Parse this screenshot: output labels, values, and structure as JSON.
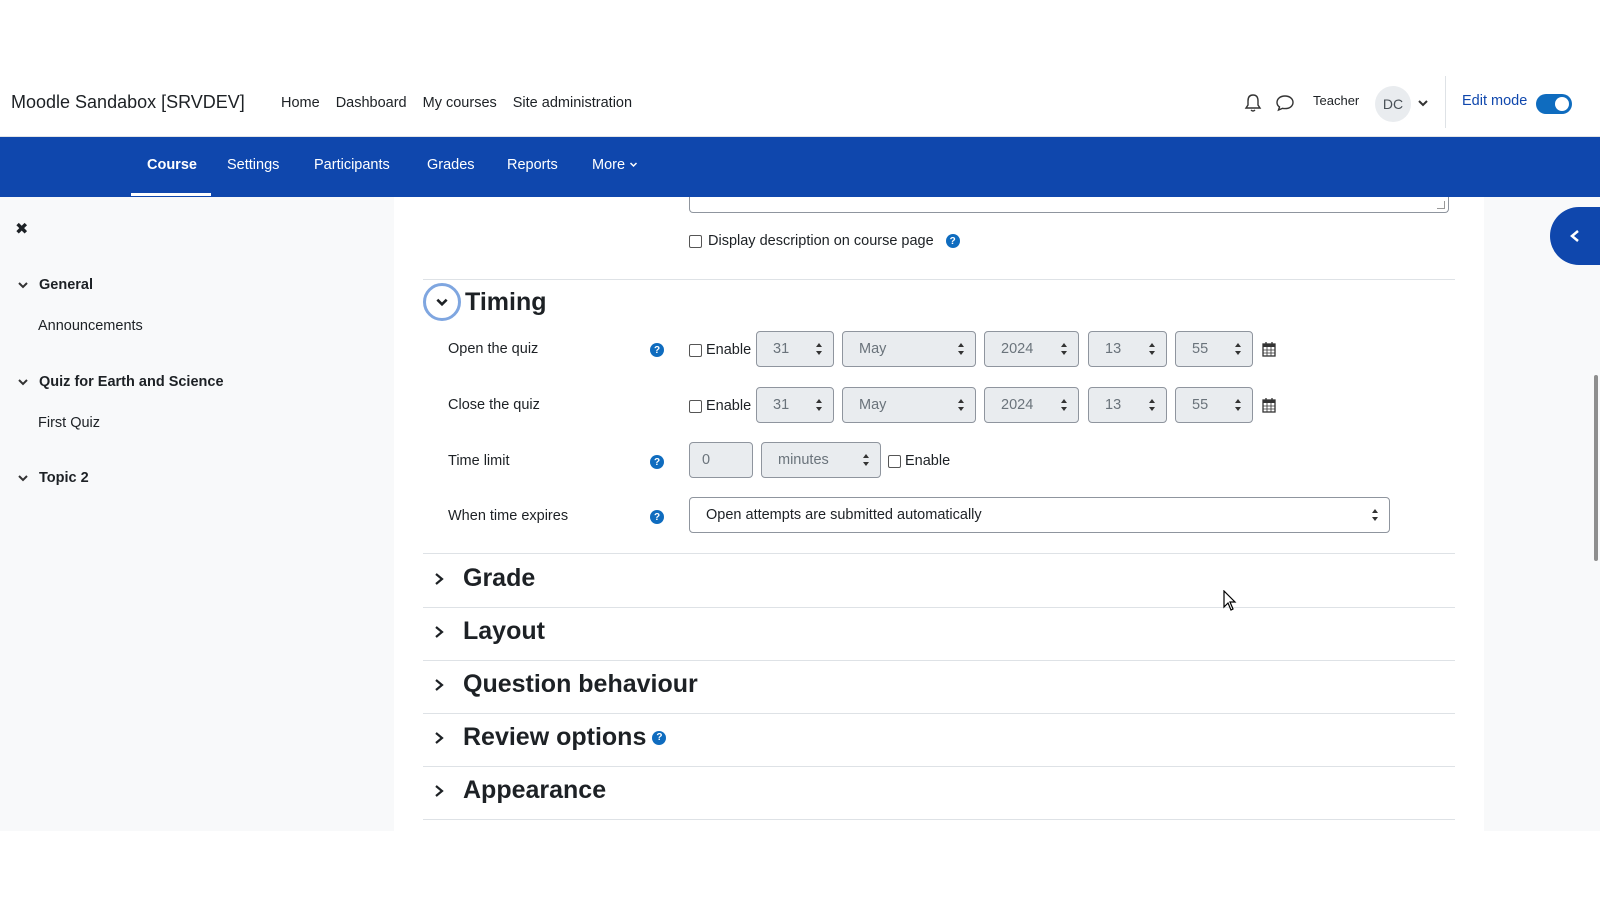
{
  "header": {
    "site_name": "Moodle Sandabox [SRVDEV]",
    "nav": [
      "Home",
      "Dashboard",
      "My courses",
      "Site administration"
    ],
    "user_name": "Teacher",
    "avatar_initials": "DC",
    "edit_mode_label": "Edit mode",
    "edit_mode_on": true
  },
  "secondary_nav": {
    "tabs": [
      "Course",
      "Settings",
      "Participants",
      "Grades",
      "Reports",
      "More"
    ],
    "active": "Course"
  },
  "drawer": {
    "close_symbol": "✖",
    "sections": [
      {
        "title": "General",
        "items": [
          "Announcements"
        ]
      },
      {
        "title": "Quiz for Earth and Science",
        "items": [
          "First Quiz"
        ]
      },
      {
        "title": "Topic 2",
        "items": []
      }
    ]
  },
  "form": {
    "display_description_label": "Display description on course page",
    "help_symbol": "?",
    "timing": {
      "title": "Timing",
      "open_quiz": {
        "label": "Open the quiz",
        "enable_label": "Enable",
        "day": "31",
        "month": "May",
        "year": "2024",
        "hour": "13",
        "minute": "55"
      },
      "close_quiz": {
        "label": "Close the quiz",
        "enable_label": "Enable",
        "day": "31",
        "month": "May",
        "year": "2024",
        "hour": "13",
        "minute": "55"
      },
      "time_limit": {
        "label": "Time limit",
        "value": "0",
        "unit": "minutes",
        "enable_label": "Enable"
      },
      "when_time_expires": {
        "label": "When time expires",
        "value": "Open attempts are submitted automatically"
      }
    },
    "collapsed_sections": [
      "Grade",
      "Layout",
      "Question behaviour",
      "Review options",
      "Appearance"
    ]
  },
  "colors": {
    "brand_blue": "#0f47ad",
    "link_blue": "#0f6cbf"
  }
}
